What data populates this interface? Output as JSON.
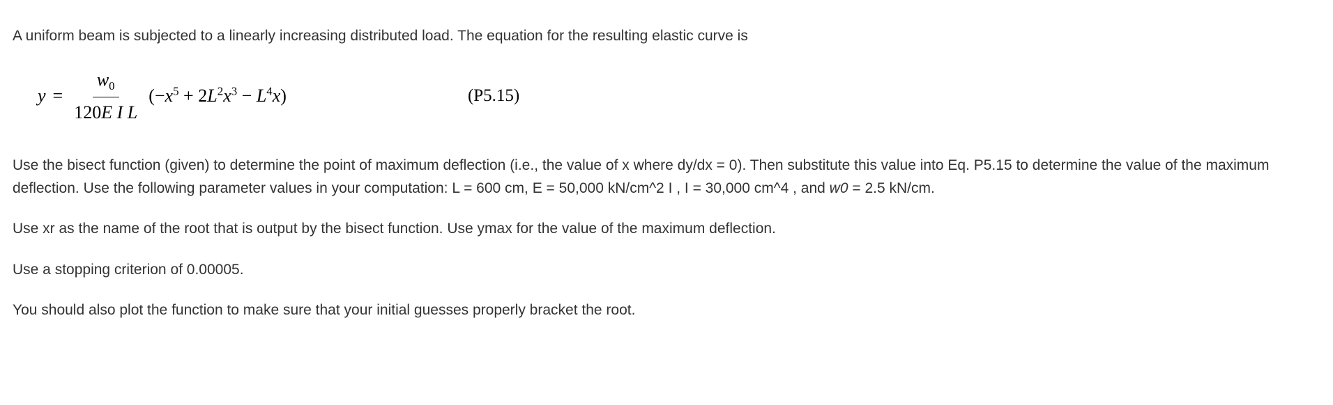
{
  "p1": "A uniform beam is subjected to a linearly increasing distributed load. The equation for the resulting elastic curve is",
  "equation": {
    "y": "y",
    "equals": "=",
    "numerator_w": "w",
    "numerator_sub": "0",
    "denominator": "120E I L",
    "poly": "(−x⁵ + 2L²x³ − L⁴x)",
    "tag": "(P5.15)"
  },
  "p2a": "Use the bisect function (given) to determine the point of maximum deflection (i.e., the value of x where dy/dx = 0). Then substitute this value into Eq. P5.15 to determine the value of the maximum deflection. Use the following parameter values in your computation: L = 600 cm, E = 50,000 kN/cm^2 I , I = 30,000 cm^4 , and ",
  "p2_w0": "w0",
  "p2b": " = 2.5 kN/cm.",
  "p3": "Use xr as the name of the root that is output by the bisect function. Use ymax for the value of the maximum deflection.",
  "p4": "Use a stopping criterion of 0.00005.",
  "p5": "You should also plot the function to make sure that your initial guesses properly bracket the root."
}
